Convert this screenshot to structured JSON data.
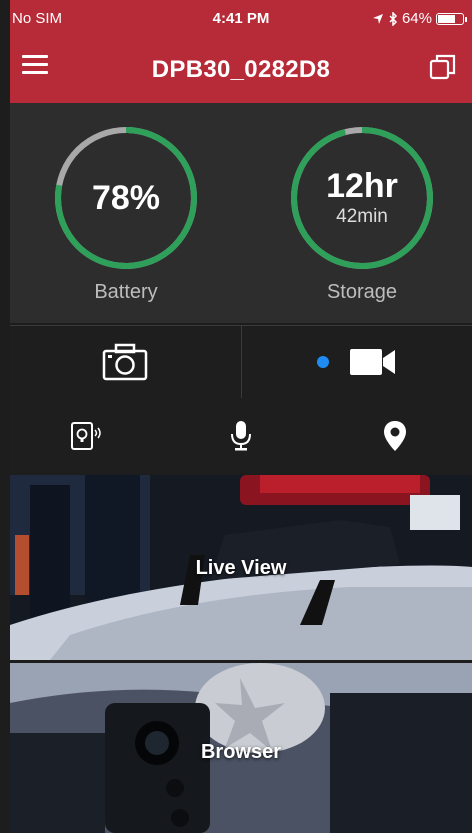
{
  "status_bar": {
    "carrier": "No SIM",
    "time": "4:41 PM",
    "battery_percent": "64%"
  },
  "header": {
    "title": "DPB30_0282D8"
  },
  "gauges": {
    "battery": {
      "value": "78%",
      "label": "Battery",
      "level": 0.78
    },
    "storage": {
      "value": "12hr",
      "sub": "42min",
      "label": "Storage",
      "level": 0.96
    }
  },
  "colors": {
    "header_red": "#b72a38",
    "gauge_green": "#2fa05a",
    "gauge_gray": "#a8a8a8",
    "rec_blue": "#1f8cf5"
  },
  "capture": {
    "photo_icon": "camera-icon",
    "video_icon": "video-camera-icon"
  },
  "tools": [
    "device-alarm-icon",
    "microphone-icon",
    "location-pin-icon"
  ],
  "tiles": {
    "live_view": "Live View",
    "browser": "Browser"
  }
}
